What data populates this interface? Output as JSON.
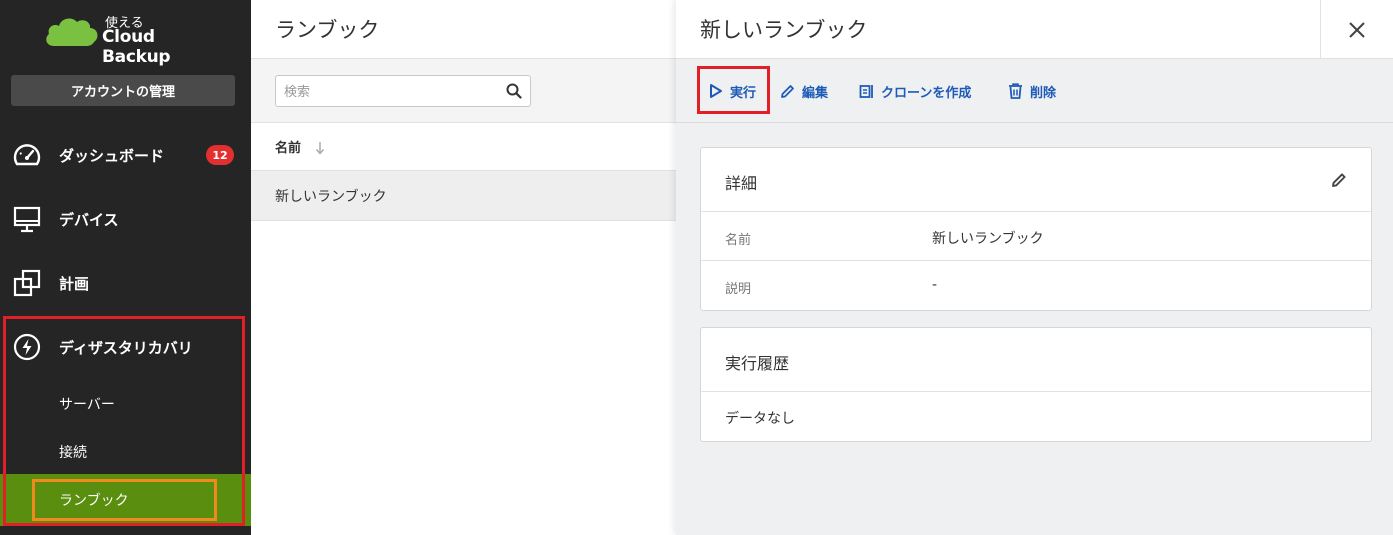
{
  "sidebar": {
    "logo_small": "使える",
    "logo_big": "Cloud Backup",
    "account_button": "アカウントの管理",
    "nav": {
      "dashboard": {
        "label": "ダッシュボード",
        "badge": "12"
      },
      "devices": {
        "label": "デバイス"
      },
      "plans": {
        "label": "計画"
      },
      "disaster_recovery": {
        "label": "ディザスタリカバリ"
      }
    },
    "sub": {
      "servers": "サーバー",
      "connection": "接続",
      "runbooks": "ランブック"
    }
  },
  "list": {
    "title": "ランブック",
    "search_placeholder": "検索",
    "column_name": "名前",
    "rows": [
      "新しいランブック"
    ]
  },
  "detail": {
    "title": "新しいランブック",
    "toolbar": {
      "run": "実行",
      "edit": "編集",
      "clone": "クローンを作成",
      "delete": "削除"
    },
    "details_card": {
      "title": "詳細",
      "rows": [
        {
          "key": "名前",
          "value": "新しいランブック"
        },
        {
          "key": "説明",
          "value": "-"
        }
      ]
    },
    "history_card": {
      "title": "実行履歴",
      "empty": "データなし"
    }
  },
  "colors": {
    "sidebar_bg": "#252525",
    "active_green": "#5a8e0e",
    "link_blue": "#1e5bb8",
    "badge_red": "#e23030",
    "highlight_red": "#e01f26",
    "highlight_orange": "#f08a1d"
  },
  "icons": [
    "cloud-logo-icon",
    "dashboard-gauge-icon",
    "monitor-icon",
    "plans-copy-icon",
    "lightning-icon",
    "search-icon",
    "sort-down-icon",
    "close-icon",
    "play-icon",
    "pencil-icon",
    "clone-icon",
    "trash-icon"
  ]
}
